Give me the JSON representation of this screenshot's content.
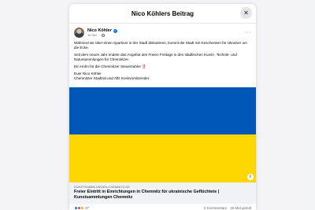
{
  "modal": {
    "title": "Nico Köhlers Beitrag",
    "close_symbol": "✕"
  },
  "post": {
    "author": "Nico Köhler",
    "time": "16 Std.",
    "paragraphs": [
      "Während wir über einen Sparkurs in der Stadt diskutieren, kommt die Stadt mit Geschenken für Ukrainer um die Ecke.",
      "Seit dem neuen Jahr endete das Angebot des Freien Freitags in den städtischen Kunst-, Technik- und Natursammlungen für Chemnitzer.",
      "Ein Hohn für die Chemnitzer Steuerzahler ‼️"
    ],
    "signature_lines": [
      "Euer Nico Köhler",
      "Chemnitzer Stadtrat und AfD Kreisvorsitzender"
    ]
  },
  "link": {
    "domain": "kunstsammlungen-chemnitz.de",
    "title": "Freier Eintritt in Einrichtungen in Chemnitz für ukrainische Geflüchtete | Kunstsammlungen Chemnitz"
  },
  "reactions": {
    "count": "37",
    "comments": "2 Kommentare",
    "shares": "26 Mal geteilt"
  },
  "colors": {
    "flag_blue": "#0057b7",
    "flag_yellow": "#ffd700",
    "verified": "#1877f2"
  },
  "icons": {
    "close": "close-icon",
    "verified": "verified-badge-icon",
    "more": "more-options-icon",
    "globe": "globe-icon",
    "info": "info-icon"
  }
}
